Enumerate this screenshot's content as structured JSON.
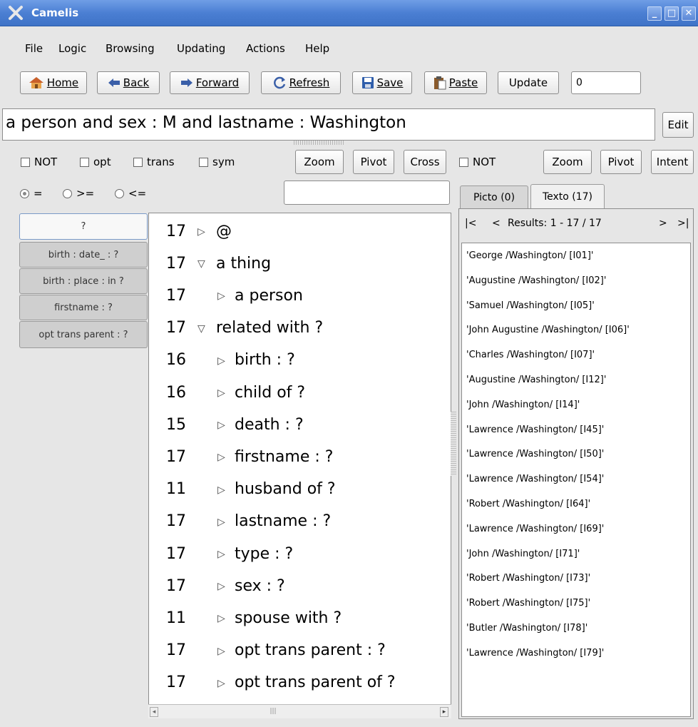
{
  "window": {
    "title": "Camelis",
    "icon": "camelis-x-icon",
    "controls": [
      "minimize-icon",
      "maximize-icon",
      "close-icon"
    ]
  },
  "menu": [
    "File",
    "Logic",
    "Browsing",
    "Updating",
    "Actions",
    "Help"
  ],
  "toolbar": {
    "home": "Home",
    "back": "Back",
    "forward": "Forward",
    "refresh": "Refresh",
    "save": "Save",
    "paste": "Paste",
    "update": "Update",
    "update_value": "0"
  },
  "query": {
    "text": "a person  and sex : M and lastname : Washington",
    "edit": "Edit"
  },
  "options_left": {
    "not": "NOT",
    "opt": "opt",
    "trans": "trans",
    "sym": "sym",
    "zoom": "Zoom",
    "pivot": "Pivot",
    "cross": "Cross"
  },
  "options_right": {
    "not": "NOT",
    "zoom": "Zoom",
    "pivot": "Pivot",
    "intent": "Intent"
  },
  "compare": {
    "eq": "=",
    "ge": ">=",
    "le": "<=",
    "selected": "=",
    "filter_value": ""
  },
  "feature_tabs": [
    "?",
    "birth : date_ : ?",
    "birth : place : in ?",
    "firstname : ?",
    "opt trans parent : ?"
  ],
  "tree": [
    {
      "count": "17",
      "arrow": "collapsed",
      "label": "@"
    },
    {
      "count": "17",
      "arrow": "expanded",
      "label": "a thing"
    },
    {
      "count": "17",
      "arrow": "collapsed",
      "label": "a person"
    },
    {
      "count": "17",
      "arrow": "expanded",
      "label": "related with ?"
    },
    {
      "count": "16",
      "arrow": "collapsed",
      "label": "birth : ?"
    },
    {
      "count": "16",
      "arrow": "collapsed",
      "label": "child of ?"
    },
    {
      "count": "15",
      "arrow": "collapsed",
      "label": "death : ?"
    },
    {
      "count": "17",
      "arrow": "collapsed",
      "label": "firstname : ?"
    },
    {
      "count": "11",
      "arrow": "collapsed",
      "label": "husband of ?"
    },
    {
      "count": "17",
      "arrow": "collapsed",
      "label": "lastname : ?"
    },
    {
      "count": "17",
      "arrow": "collapsed",
      "label": "type : ?"
    },
    {
      "count": "17",
      "arrow": "collapsed",
      "label": "sex : ?"
    },
    {
      "count": "11",
      "arrow": "collapsed",
      "label": "spouse with ?"
    },
    {
      "count": "17",
      "arrow": "collapsed",
      "label": "opt trans parent : ?"
    },
    {
      "count": "17",
      "arrow": "collapsed",
      "label": "opt trans parent of ?"
    }
  ],
  "result_tabs": {
    "picto": "Picto (0)",
    "texto": "Texto (17)"
  },
  "results_nav": {
    "first": "|<",
    "prev": "<",
    "summary": "Results: 1 - 17 / 17",
    "next": ">",
    "last": ">|"
  },
  "results": [
    "'George /Washington/ [I01]'",
    "'Augustine /Washington/ [I02]'",
    "'Samuel /Washington/ [I05]'",
    "'John Augustine /Washington/ [I06]'",
    "'Charles /Washington/ [I07]'",
    "'Augustine /Washington/ [I12]'",
    "'John /Washington/ [I14]'",
    "'Lawrence /Washington/ [I45]'",
    "'Lawrence /Washington/ [I50]'",
    "'Lawrence /Washington/ [I54]'",
    "'Robert /Washington/ [I64]'",
    "'Lawrence /Washington/ [I69]'",
    "'John /Washington/ [I71]'",
    "'Robert /Washington/ [I73]'",
    "'Robert /Washington/ [I75]'",
    "'Butler /Washington/ [I78]'",
    "'Lawrence /Washington/ [I79]'"
  ]
}
